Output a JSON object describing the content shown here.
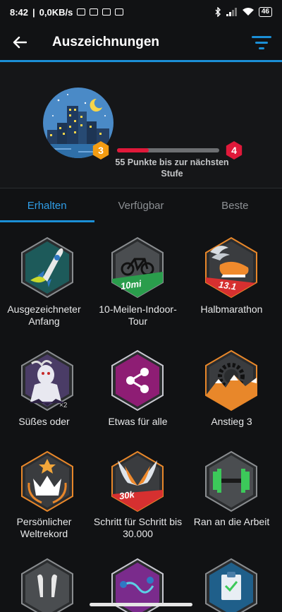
{
  "status_bar": {
    "time": "8:42",
    "speed": "0,0KB/s",
    "battery": "46"
  },
  "app_bar": {
    "title": "Auszeichnungen",
    "back_icon": "arrow-left-icon",
    "filter_icon": "filter-icon"
  },
  "level": {
    "current": "3",
    "next": "4",
    "progress_fraction": 0.31,
    "progress_text": "55 Punkte bis zur nächsten Stufe"
  },
  "tabs": [
    {
      "label": "Erhalten",
      "active": true
    },
    {
      "label": "Verfügbar",
      "active": false
    },
    {
      "label": "Beste",
      "active": false
    }
  ],
  "badges": [
    {
      "label": "Ausgezeichneter Anfang",
      "icon": "rocket-icon"
    },
    {
      "label": "10-Meilen-Indoor-Tour",
      "icon": "indoor-bike-icon",
      "ribbon": "10mi"
    },
    {
      "label": "Halbmarathon",
      "icon": "winged-shoe-icon",
      "ribbon": "13.1"
    },
    {
      "label": "Süßes oder",
      "icon": "vampire-icon",
      "multiplier": "×2"
    },
    {
      "label": "Etwas für alle",
      "icon": "share-icon"
    },
    {
      "label": "Anstieg 3",
      "icon": "mountain-gear-icon"
    },
    {
      "label": "Persönlicher Weltrekord",
      "icon": "crown-icon"
    },
    {
      "label": "Schritt für Schritt bis 30.000",
      "icon": "winged-steps-icon",
      "ribbon": "30k"
    },
    {
      "label": "Ran an die Arbeit",
      "icon": "dumbbell-icon"
    },
    {
      "label": "",
      "icon": "earbuds-icon"
    },
    {
      "label": "",
      "icon": "map-route-icon"
    },
    {
      "label": "",
      "icon": "clipboard-check-icon"
    }
  ]
}
